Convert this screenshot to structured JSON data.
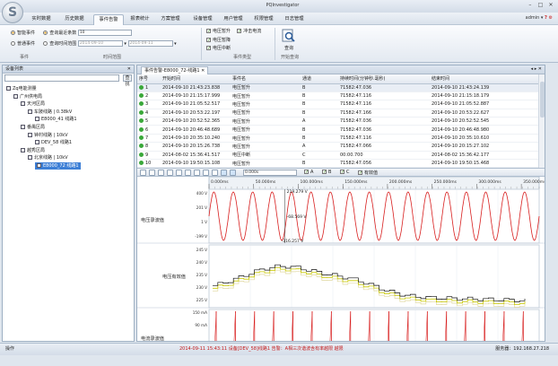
{
  "app": {
    "title": "PQInvestigator",
    "logo_letter": "S"
  },
  "window": {
    "min": "–",
    "max": "□",
    "close": "✕"
  },
  "menu": {
    "tabs": [
      "实时数据",
      "历史数据",
      "事件告警",
      "报表统计",
      "方案管理",
      "设备管理",
      "用户管理",
      "权限管理",
      "日志管理"
    ],
    "active": 2
  },
  "user": {
    "name": "admin",
    "arrow": "▾",
    "help": "?"
  },
  "ribbon": {
    "smart_event": "智能事件",
    "event_query_count_label": "查询最近条数",
    "event_query_count_value": "10",
    "ordinary_event": "普通事件",
    "query_time_range_label": "查询时间范围",
    "date_from": "2014-09-10",
    "date_to": "2014-09-11",
    "group_event": "事件",
    "group_time": "时间范围",
    "cb_voltage_sag": "电压暂升",
    "cb_inrush": "冲击电流",
    "cb_voltage_dip": "电压暂降",
    "cb_voltage_interrupt": "电压中断",
    "group_event_type": "事件类型",
    "query_button": "查询",
    "group_start_query": "开始查询"
  },
  "left_panel": {
    "title": "设备列表",
    "close": "✕",
    "search_btn": "查找",
    "tree": [
      {
        "label": "Zq电能测量",
        "level": 0,
        "selected": false
      },
      {
        "label": "广州供电局",
        "level": 1,
        "selected": false
      },
      {
        "label": "天河区局",
        "level": 2,
        "selected": false
      },
      {
        "label": "车陂线路 | 0.38kV",
        "level": 3,
        "selected": false
      },
      {
        "label": "E8000_41 线路1",
        "level": 4,
        "selected": false
      },
      {
        "label": "番禺区局",
        "level": 2,
        "selected": false
      },
      {
        "label": "钟村线路 | 10kV",
        "level": 3,
        "selected": false
      },
      {
        "label": "DEV_58 线路1",
        "level": 4,
        "selected": false
      },
      {
        "label": "越秀区局",
        "level": 2,
        "selected": false
      },
      {
        "label": "北京线路 | 10kV",
        "level": 3,
        "selected": false
      },
      {
        "label": "E8000_72 线路1",
        "level": 4,
        "selected": true
      }
    ]
  },
  "doc_tab": {
    "label": "事件告警-E8000_72-线路1",
    "close": "✕",
    "controls": "◂ ▸ ✕"
  },
  "table": {
    "headers": [
      "序号",
      "开始时间",
      "事件名",
      "通道",
      "持续时间(分钟秒.毫秒)",
      "结束时间"
    ],
    "rows": [
      [
        "1",
        "2014-09-10 21:43:23.838",
        "电压暂升",
        "B",
        "71582:47.036",
        "2014-09-10 21:43:24.139"
      ],
      [
        "2",
        "2014-09-10 21:15:17.999",
        "电压暂升",
        "B",
        "71582:47.116",
        "2014-09-10 21:15:18.179"
      ],
      [
        "3",
        "2014-09-10 21:05:52.517",
        "电压暂升",
        "B",
        "71582:47.116",
        "2014-09-10 21:05:52.887"
      ],
      [
        "4",
        "2014-09-10 20:53:22.197",
        "电压暂升",
        "B",
        "71582:47.166",
        "2014-09-10 20:53:22.627"
      ],
      [
        "5",
        "2014-09-10 20:52:52.365",
        "电压暂升",
        "A",
        "71582:47.036",
        "2014-09-10 20:52:52.545"
      ],
      [
        "6",
        "2014-09-10 20:46:48.689",
        "电压暂升",
        "B",
        "71582:47.036",
        "2014-09-10 20:46:48.980"
      ],
      [
        "7",
        "2014-09-10 20:35:10.240",
        "电压暂升",
        "B",
        "71582:47.116",
        "2014-09-10 20:35:10.610"
      ],
      [
        "8",
        "2014-09-10 20:15:26.738",
        "电压暂升",
        "A",
        "71582:47.066",
        "2014-09-10 20:15:27.102"
      ],
      [
        "9",
        "2014-08-02 15:36:41.517",
        "电压中断",
        "C",
        "00:00.700",
        "2014-08-02 15:36:42.177"
      ],
      [
        "10",
        "2014-09-10 19:50:15.108",
        "电压暂升",
        "B",
        "71582:47.056",
        "2014-09-10 19:50:15.468"
      ]
    ]
  },
  "wave_toolbar": {
    "time_value": "0.000s",
    "cb_a": "A",
    "cb_b": "B",
    "cb_c": "C",
    "cb_valid": "有效值"
  },
  "chart": {
    "ticks": [
      "0.000ms",
      "50.000ms",
      "100.000ms",
      "150.000ms",
      "200.000ms",
      "250.000ms",
      "300.000ms",
      "350.000ms"
    ],
    "panel1_label": "电压录波值",
    "panel2_label": "电压有效值",
    "panel3_label": "电流录波值",
    "p1_axis": [
      "400 V",
      "201 V",
      "1 V",
      "-199 V"
    ],
    "p2_axis": [
      "245 V",
      "240 V",
      "235 V",
      "230 V",
      "225 V"
    ],
    "p3_axis": [
      "150 mA",
      "90 mA"
    ],
    "cursor_top": "219.279 V",
    "cursor_mid": "-68.569 V",
    "cursor_bottom": "-316.257 V",
    "colors": {
      "wave": "#d81e1e",
      "rms1": "#111111",
      "rms2": "#c8c800",
      "rms3": "#e0d8a0",
      "grid": "#dfe5ec"
    }
  },
  "status": {
    "left": "操作",
    "middle": "2014-09-11 15:43:11 设备[DEV_58]线路1 告警：A相三次谐波含有率越限 越限",
    "right": "服务器：192.168.27.218"
  }
}
